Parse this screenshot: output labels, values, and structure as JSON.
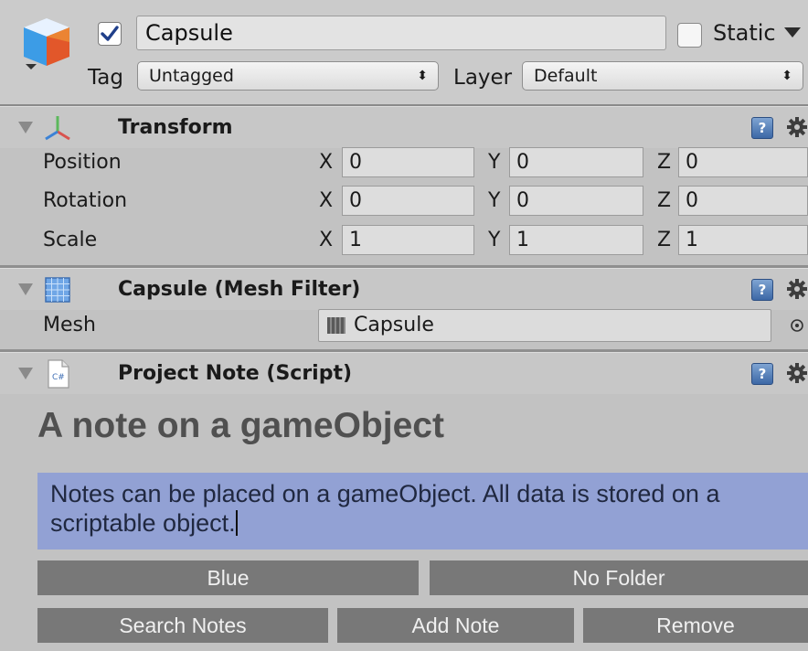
{
  "header": {
    "active_checked": true,
    "object_name": "Capsule",
    "static_label": "Static",
    "tag_label": "Tag",
    "tag_value": "Untagged",
    "layer_label": "Layer",
    "layer_value": "Default"
  },
  "transform": {
    "title": "Transform",
    "rows": [
      {
        "label": "Position",
        "x": "0",
        "y": "0",
        "z": "0"
      },
      {
        "label": "Rotation",
        "x": "0",
        "y": "0",
        "z": "0"
      },
      {
        "label": "Scale",
        "x": "1",
        "y": "1",
        "z": "1"
      }
    ],
    "axis_x": "X",
    "axis_y": "Y",
    "axis_z": "Z"
  },
  "mesh_filter": {
    "title": "Capsule (Mesh Filter)",
    "mesh_label": "Mesh",
    "mesh_value": "Capsule"
  },
  "project_note": {
    "title": "Project Note (Script)",
    "script_icon_text": "C#",
    "heading": "A note on a gameObject",
    "note_text": "Notes can be placed on a gameObject. All data is stored on a scriptable object.",
    "note_bg_color": "#92a1d4",
    "buttons": {
      "color": "Blue",
      "folder": "No Folder",
      "search": "Search Notes",
      "add": "Add Note",
      "remove": "Remove"
    }
  },
  "icons": {
    "help": "?",
    "target": "⊙"
  }
}
